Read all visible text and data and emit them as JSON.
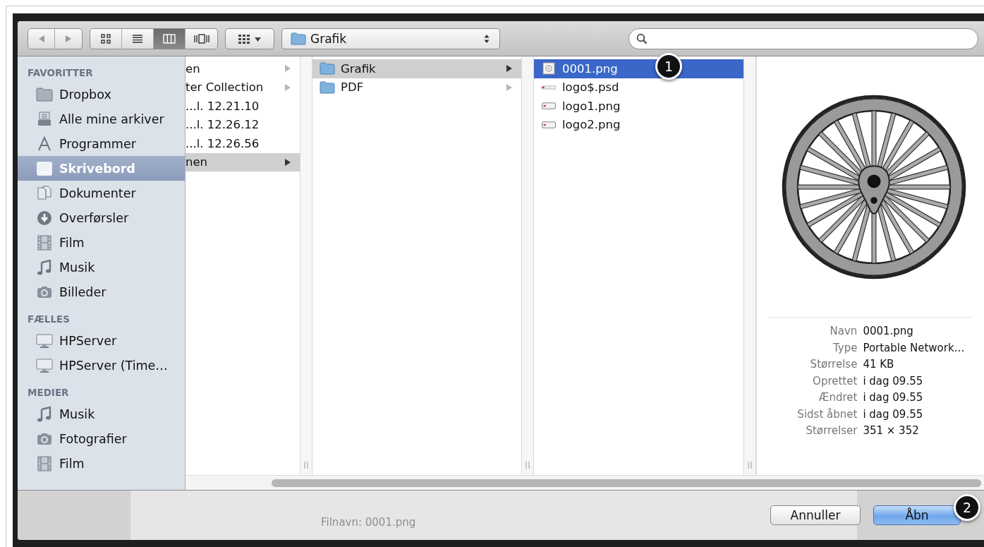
{
  "toolbar": {
    "view_modes": [
      {
        "kind": "icons",
        "selected": false
      },
      {
        "kind": "list",
        "selected": false
      },
      {
        "kind": "columns",
        "selected": true
      },
      {
        "kind": "coverflow",
        "selected": false
      }
    ],
    "path_popup": {
      "label": "Grafik"
    }
  },
  "sidebar": {
    "sections": [
      {
        "title": "FAVORITTER",
        "items": [
          {
            "label": "Dropbox",
            "kind": "folder",
            "selected": false
          },
          {
            "label": "Alle mine arkiver",
            "kind": "stack",
            "selected": false
          },
          {
            "label": "Programmer",
            "kind": "apps",
            "selected": false
          },
          {
            "label": "Skrivebord",
            "kind": "desktop",
            "selected": true
          },
          {
            "label": "Dokumenter",
            "kind": "documents",
            "selected": false
          },
          {
            "label": "Overførsler",
            "kind": "download",
            "selected": false
          },
          {
            "label": "Film",
            "kind": "film",
            "selected": false
          },
          {
            "label": "Musik",
            "kind": "music",
            "selected": false
          },
          {
            "label": "Billeder",
            "kind": "camera",
            "selected": false
          }
        ]
      },
      {
        "title": "FÆLLES",
        "items": [
          {
            "label": "HPServer",
            "kind": "monitor",
            "selected": false
          },
          {
            "label": "HPServer (Time…",
            "kind": "monitor",
            "selected": false
          }
        ]
      },
      {
        "title": "MEDIER",
        "items": [
          {
            "label": "Musik",
            "kind": "music",
            "selected": false
          },
          {
            "label": "Fotografier",
            "kind": "camera",
            "selected": false
          },
          {
            "label": "Film",
            "kind": "film",
            "selected": false
          }
        ]
      }
    ]
  },
  "columns": [
    {
      "active": false,
      "items": [
        {
          "label": "en",
          "kind": "none",
          "has_children": true,
          "selected": false
        },
        {
          "label": "ter Collection",
          "kind": "none",
          "has_children": true,
          "selected": false
        },
        {
          "label": "...l. 12.21.10",
          "kind": "none",
          "has_children": false,
          "selected": false
        },
        {
          "label": "...l. 12.26.12",
          "kind": "none",
          "has_children": false,
          "selected": false
        },
        {
          "label": "...l. 12.26.56",
          "kind": "none",
          "has_children": false,
          "selected": false
        },
        {
          "label": "nen",
          "kind": "none",
          "has_children": true,
          "selected": true
        }
      ]
    },
    {
      "active": false,
      "items": [
        {
          "label": "Grafik",
          "kind": "folder",
          "has_children": true,
          "selected": true
        },
        {
          "label": "PDF",
          "kind": "folder",
          "has_children": true,
          "selected": false
        }
      ]
    },
    {
      "active": true,
      "items": [
        {
          "label": "0001.png",
          "kind": "image",
          "has_children": false,
          "selected": true,
          "callout": "1"
        },
        {
          "label": "logo$.psd",
          "kind": "psd",
          "has_children": false,
          "selected": false
        },
        {
          "label": "logo1.png",
          "kind": "png",
          "has_children": false,
          "selected": false
        },
        {
          "label": "logo2.png",
          "kind": "png",
          "has_children": false,
          "selected": false
        }
      ]
    }
  ],
  "preview": {
    "info": [
      {
        "label": "Navn",
        "value": "0001.png"
      },
      {
        "label": "Type",
        "value": "Portable Network…"
      },
      {
        "label": "Størrelse",
        "value": "41 KB"
      },
      {
        "label": "Oprettet",
        "value": "i dag 09.55"
      },
      {
        "label": "Ændret",
        "value": "i dag 09.55"
      },
      {
        "label": "Sidst åbnet",
        "value": "i dag 09.55"
      },
      {
        "label": "Størrelser",
        "value": "351 × 352"
      }
    ]
  },
  "background": {
    "filename_hint": "Filnavn: 0001.png"
  },
  "buttons": [
    {
      "label": "Annuller",
      "kind": "cancel"
    },
    {
      "label": "Åbn",
      "kind": "default",
      "callout": "2"
    }
  ]
}
